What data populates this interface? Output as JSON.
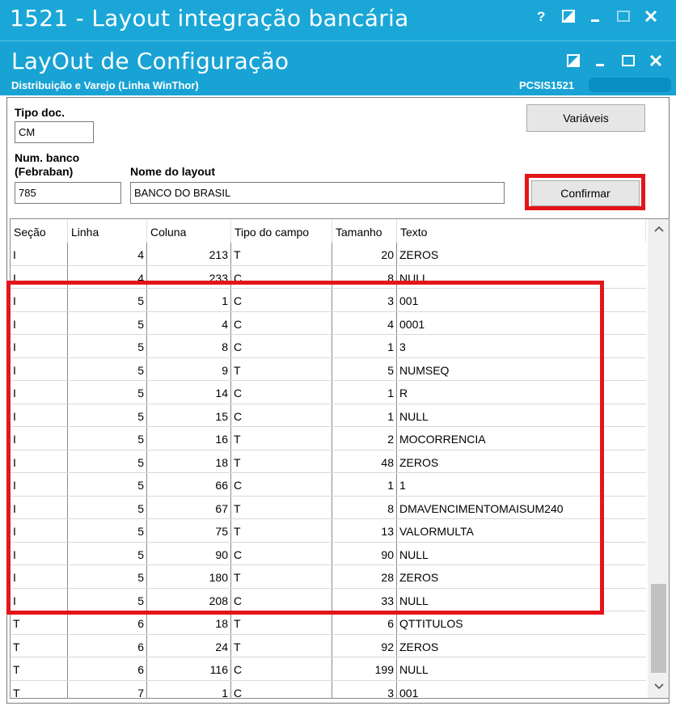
{
  "app": {
    "title": "1521 - Layout integração bancária",
    "window_buttons": [
      "help",
      "restore",
      "minimize",
      "maximize",
      "close"
    ]
  },
  "form": {
    "title": "LayOut de Configuração",
    "subtitle": "Distribuição e Varejo (Linha WinThor)",
    "code": "PCSIS1521"
  },
  "fields": {
    "tipo_doc_label": "Tipo doc.",
    "tipo_doc_value": "CM",
    "num_banco_label_1": "Num. banco",
    "num_banco_label_2": "(Febraban)",
    "num_banco_value": "785",
    "nome_layout_label": "Nome do layout",
    "nome_layout_value": "BANCO DO BRASIL"
  },
  "buttons": {
    "variaveis": "Variáveis",
    "confirmar": "Confirmar"
  },
  "table": {
    "headers": [
      "Seção",
      "Linha",
      "Coluna",
      "Tipo do campo",
      "Tamanho",
      "Texto"
    ],
    "rows": [
      [
        "I",
        "4",
        "213",
        "T",
        "20",
        "ZEROS"
      ],
      [
        "I",
        "4",
        "233",
        "C",
        "8",
        "NULL"
      ],
      [
        "I",
        "5",
        "1",
        "C",
        "3",
        "001"
      ],
      [
        "I",
        "5",
        "4",
        "C",
        "4",
        "0001"
      ],
      [
        "I",
        "5",
        "8",
        "C",
        "1",
        "3"
      ],
      [
        "I",
        "5",
        "9",
        "T",
        "5",
        "NUMSEQ"
      ],
      [
        "I",
        "5",
        "14",
        "C",
        "1",
        "R"
      ],
      [
        "I",
        "5",
        "15",
        "C",
        "1",
        "NULL"
      ],
      [
        "I",
        "5",
        "16",
        "T",
        "2",
        "MOCORRENCIA"
      ],
      [
        "I",
        "5",
        "18",
        "T",
        "48",
        "ZEROS"
      ],
      [
        "I",
        "5",
        "66",
        "C",
        "1",
        "1"
      ],
      [
        "I",
        "5",
        "67",
        "T",
        "8",
        "DMAVENCIMENTOMAISUM240"
      ],
      [
        "I",
        "5",
        "75",
        "T",
        "13",
        "VALORMULTA"
      ],
      [
        "I",
        "5",
        "90",
        "C",
        "90",
        "NULL"
      ],
      [
        "I",
        "5",
        "180",
        "T",
        "28",
        "ZEROS"
      ],
      [
        "I",
        "5",
        "208",
        "C",
        "33",
        "NULL"
      ],
      [
        "T",
        "6",
        "18",
        "T",
        "6",
        "QTTITULOS"
      ],
      [
        "T",
        "6",
        "24",
        "T",
        "92",
        "ZEROS"
      ],
      [
        "T",
        "6",
        "116",
        "C",
        "199",
        "NULL"
      ],
      [
        "T",
        "7",
        "1",
        "C",
        "3",
        "001"
      ]
    ]
  },
  "colors": {
    "titlebar": "#1aa7d8",
    "highlight": "#e3151b"
  }
}
